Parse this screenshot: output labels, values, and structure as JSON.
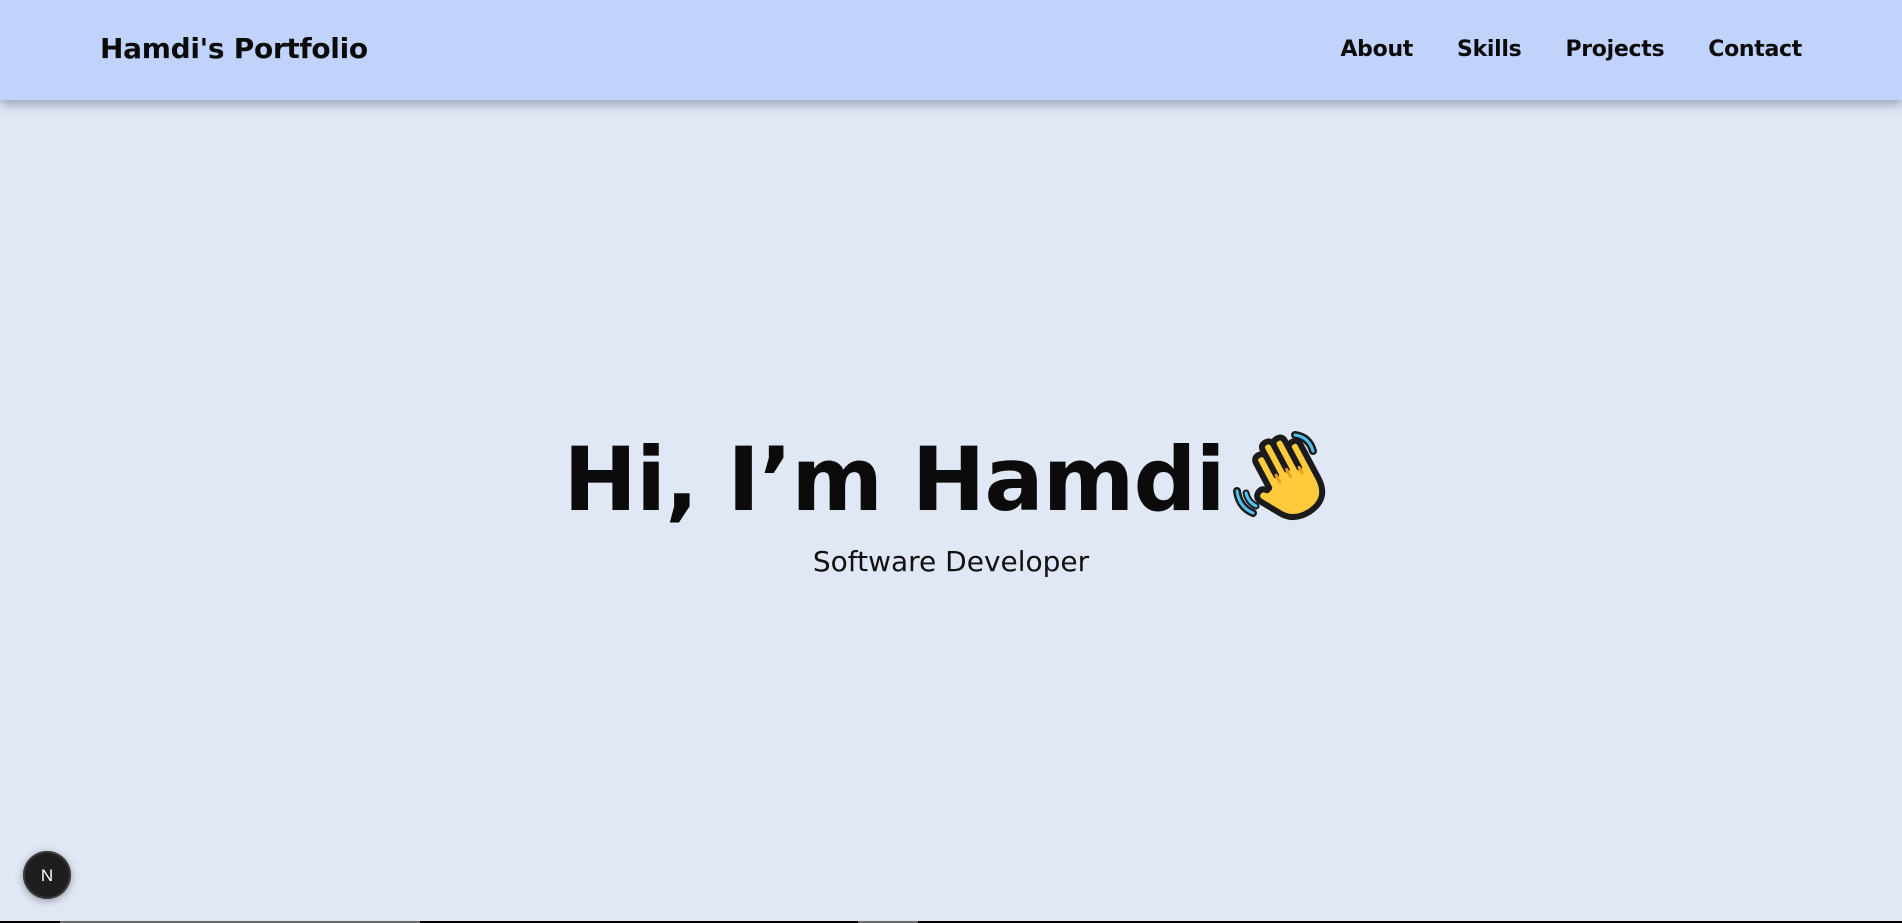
{
  "header": {
    "brand": "Hamdi's Portfolio",
    "nav": [
      {
        "label": "About"
      },
      {
        "label": "Skills"
      },
      {
        "label": "Projects"
      },
      {
        "label": "Contact"
      }
    ]
  },
  "hero": {
    "title": "Hi, I’m Hamdi",
    "icon": "waving-hand-icon",
    "subtitle": "Software Developer"
  },
  "badge": {
    "icon": "nextjs-logo-icon",
    "letter": "N"
  },
  "colors": {
    "navbar_bg": "#c1d3fa",
    "page_bg": "#e0e7f5",
    "text": "#0b0b0b",
    "badge_bg": "#1e1e1e"
  }
}
